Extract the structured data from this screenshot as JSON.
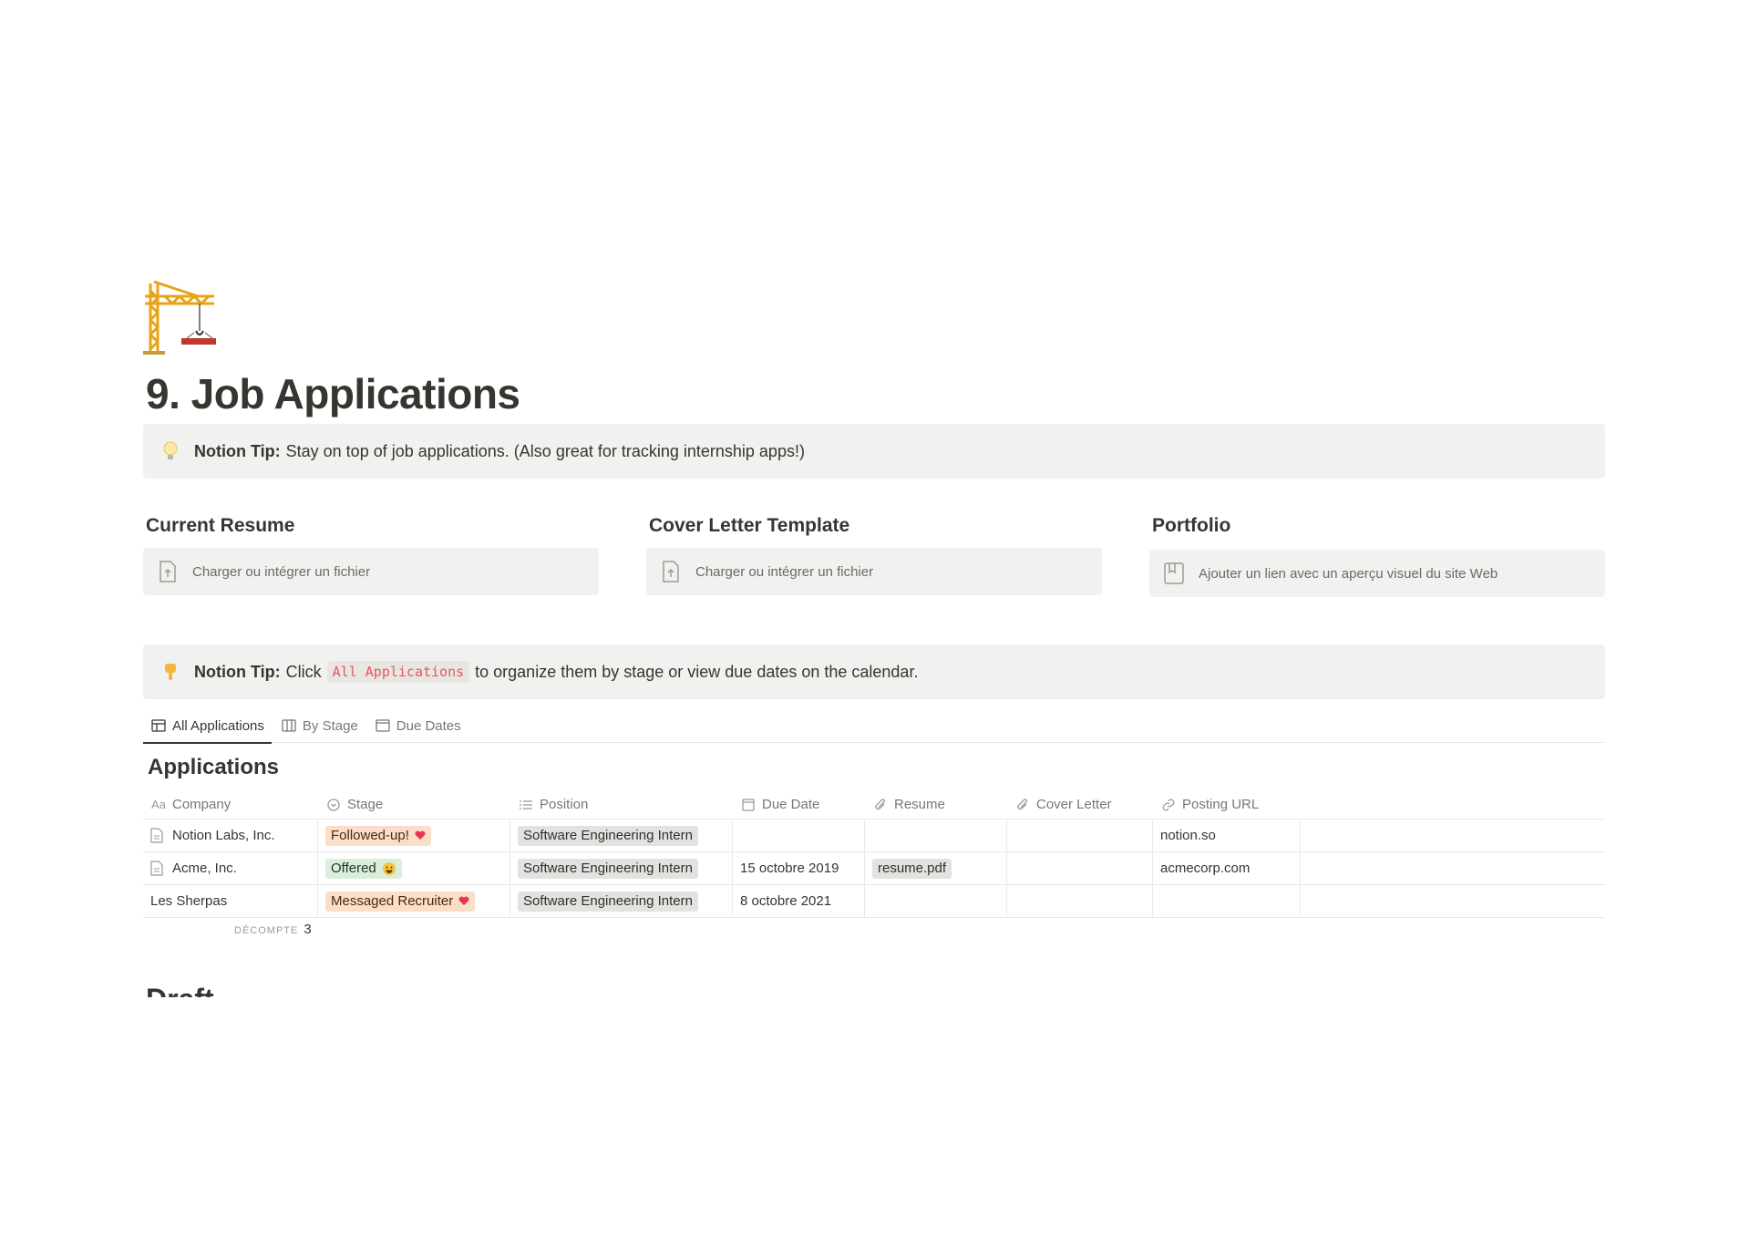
{
  "page": {
    "icon": "construction-crane-icon",
    "title": "9. Job Applications"
  },
  "callout_top": {
    "icon": "light-bulb-icon",
    "bold": "Notion Tip:",
    "text": "Stay on top of job applications. (Also great for tracking internship apps!)"
  },
  "columns": [
    {
      "heading": "Current Resume",
      "placeholder": "Charger ou intégrer un fichier",
      "icon": "file-upload-icon"
    },
    {
      "heading": "Cover Letter Template",
      "placeholder": "Charger ou intégrer un fichier",
      "icon": "file-upload-icon"
    },
    {
      "heading": "Portfolio",
      "placeholder": "Ajouter un lien avec un aperçu visuel du site Web",
      "icon": "bookmark-icon"
    }
  ],
  "callout_bottom": {
    "icon": "pointing-down-icon",
    "bold": "Notion Tip:",
    "pre": "Click",
    "code": "All Applications",
    "post": "to organize them by stage or view due dates on the calendar."
  },
  "tabs": [
    {
      "label": "All Applications",
      "icon": "table-icon",
      "active": true
    },
    {
      "label": "By Stage",
      "icon": "board-icon",
      "active": false
    },
    {
      "label": "Due Dates",
      "icon": "calendar-icon",
      "active": false
    }
  ],
  "database": {
    "title": "Applications",
    "columns": [
      {
        "label": "Company",
        "icon": "Aa"
      },
      {
        "label": "Stage",
        "icon": "select-icon"
      },
      {
        "label": "Position",
        "icon": "list-icon"
      },
      {
        "label": "Due Date",
        "icon": "calendar-icon"
      },
      {
        "label": "Resume",
        "icon": "paperclip-icon"
      },
      {
        "label": "Cover Letter",
        "icon": "paperclip-icon"
      },
      {
        "label": "Posting URL",
        "icon": "link-icon"
      }
    ],
    "rows": [
      {
        "company": "Notion Labs, Inc.",
        "has_doc_icon": true,
        "stage": "Followed-up!",
        "stage_emoji": "heart",
        "position": "Software Engineering Intern",
        "due_date": "",
        "resume": "",
        "cover_letter": "",
        "url": "notion.so"
      },
      {
        "company": "Acme, Inc.",
        "has_doc_icon": true,
        "stage": "Offered",
        "stage_emoji": "smile",
        "position": "Software Engineering Intern",
        "due_date": "15 octobre 2019",
        "resume": "resume.pdf",
        "cover_letter": "",
        "url": "acmecorp.com"
      },
      {
        "company": "Les Sherpas",
        "has_doc_icon": false,
        "stage": "Messaged Recruiter",
        "stage_emoji": "heart",
        "position": "Software Engineering Intern",
        "due_date": "8 octobre 2021",
        "resume": "",
        "cover_letter": "",
        "url": ""
      }
    ],
    "count_label": "DÉCOMPTE",
    "count_value": "3"
  },
  "next_heading": "Draft",
  "colors": {
    "callout_bg": "#f1f1ef",
    "text": "#37352f",
    "muted": "#787774",
    "code_red": "#eb5757"
  }
}
